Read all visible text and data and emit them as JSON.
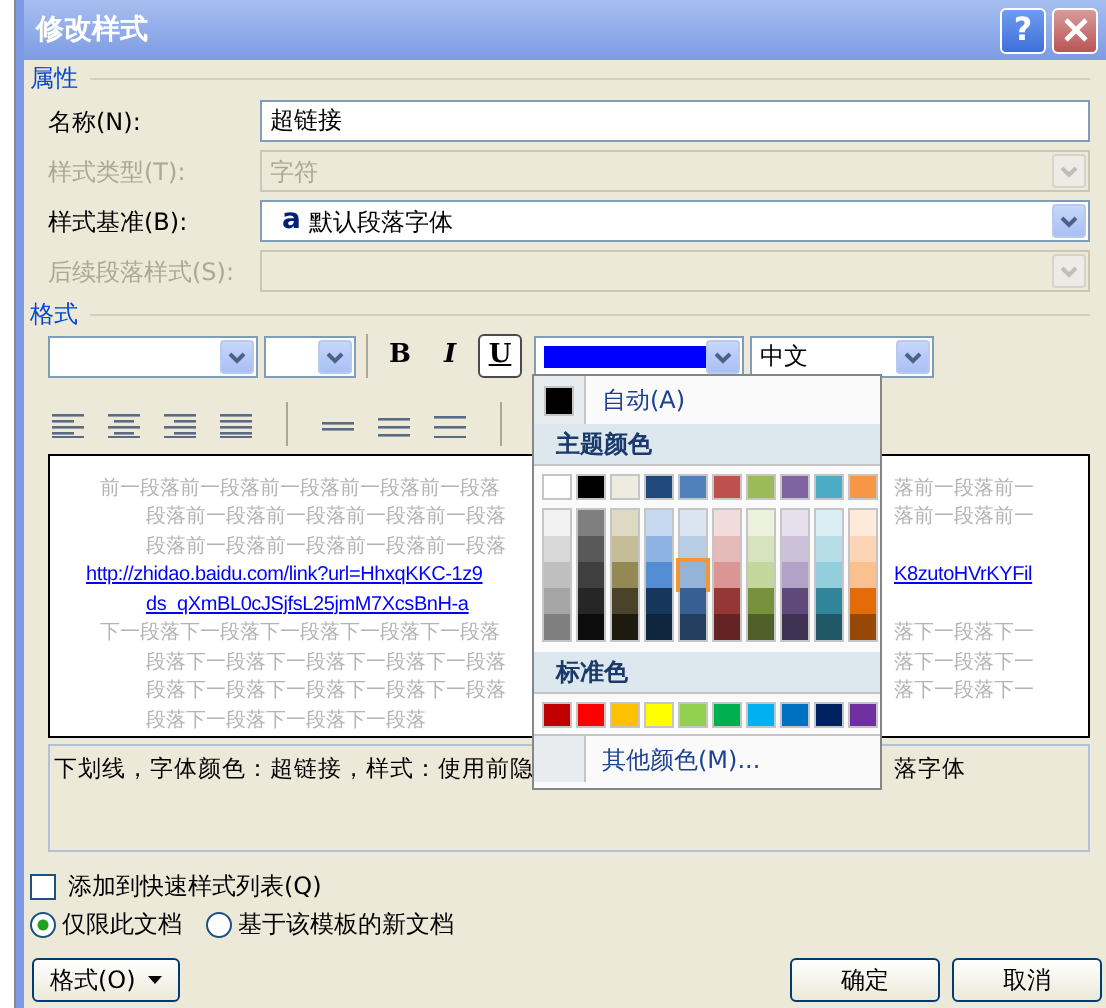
{
  "window": {
    "title": "修改样式",
    "help": "?"
  },
  "properties": {
    "heading": "属性",
    "fields": [
      {
        "label": "名称(N):",
        "kind": "text",
        "value": "超链接",
        "disabled": false
      },
      {
        "label": "样式类型(T):",
        "kind": "select",
        "value": "字符",
        "disabled": true
      },
      {
        "label": "样式基准(B):",
        "kind": "select",
        "value": "默认段落字体",
        "icon": "a",
        "disabled": false
      },
      {
        "label": "后续段落样式(S):",
        "kind": "select",
        "disabled": true
      }
    ]
  },
  "format": {
    "heading": "格式",
    "toolbar": {
      "bold": {
        "label": "B",
        "on": false
      },
      "italic": {
        "label": "I",
        "on": false
      },
      "underline": {
        "label": "U",
        "on": true
      },
      "font_color": {
        "color": "#0000ff"
      },
      "language": "中文"
    },
    "preview": [
      {
        "kind": "para-start",
        "left": "前一段落前一段落前一段落前一段落前一段落",
        "right": "落前一段落前一"
      },
      {
        "kind": "continuation",
        "left": "段落前一段落前一段落前一段落前一段落",
        "right": "落前一段落前一"
      },
      {
        "kind": "continuation",
        "left": "段落前一段落前一段落前一段落前一段落"
      },
      {
        "kind": "link",
        "left": "http://zhidao.baidu.com/link?url=HhxqKKC-1z9",
        "right": "K8zutoHVrKYFil"
      },
      {
        "kind": "link-continuation",
        "left": "ds_qXmBL0cJSjfsL25jmM7XcsBnH-a"
      },
      {
        "kind": "para-start",
        "left": "下一段落下一段落下一段落下一段落下一段落",
        "right": "落下一段落下一"
      },
      {
        "kind": "continuation",
        "left": "段落下一段落下一段落下一段落下一段落",
        "right": "落下一段落下一"
      },
      {
        "kind": "continuation",
        "left": "段落下一段落下一段落下一段落下一段落",
        "right": "落下一段落下一"
      },
      {
        "kind": "continuation",
        "left": "段落下一段落下一段落下一段落"
      }
    ],
    "description": {
      "left": "下划线，字体颜色：超链接，样式：使用前隐",
      "right": "落字体"
    }
  },
  "palette": {
    "auto": {
      "label": "自动(A)",
      "color": "#000000"
    },
    "theme_heading": "主题颜色",
    "theme": [
      {
        "color": "#ffffff",
        "selected": false
      },
      {
        "color": "#000000",
        "selected": false
      },
      {
        "color": "#eeece1",
        "selected": false
      },
      {
        "color": "#1f497d",
        "selected": false
      },
      {
        "color": "#4f81bd",
        "selected": false
      },
      {
        "color": "#c0504d",
        "selected": false
      },
      {
        "color": "#9bbb59",
        "selected": false
      },
      {
        "color": "#8064a2",
        "selected": false
      },
      {
        "color": "#4bacc6",
        "selected": false
      },
      {
        "color": "#f79646",
        "selected": false
      }
    ],
    "shade_columns": [
      [
        {
          "color": "#f2f2f2",
          "selected": false
        },
        {
          "color": "#d8d8d8",
          "selected": false
        },
        {
          "color": "#bfbfbf",
          "selected": false
        },
        {
          "color": "#a5a5a5",
          "selected": false
        },
        {
          "color": "#7f7f7f",
          "selected": false
        }
      ],
      [
        {
          "color": "#7f7f7f",
          "selected": false
        },
        {
          "color": "#595959",
          "selected": false
        },
        {
          "color": "#3f3f3f",
          "selected": false
        },
        {
          "color": "#262626",
          "selected": false
        },
        {
          "color": "#0c0c0c",
          "selected": false
        }
      ],
      [
        {
          "color": "#ddd9c3",
          "selected": false
        },
        {
          "color": "#c4bd97",
          "selected": false
        },
        {
          "color": "#938953",
          "selected": false
        },
        {
          "color": "#494429",
          "selected": false
        },
        {
          "color": "#1d1b10",
          "selected": false
        }
      ],
      [
        {
          "color": "#c6d9f0",
          "selected": false
        },
        {
          "color": "#8db3e2",
          "selected": false
        },
        {
          "color": "#548dd4",
          "selected": false
        },
        {
          "color": "#17365d",
          "selected": false
        },
        {
          "color": "#0f243e",
          "selected": false
        }
      ],
      [
        {
          "color": "#dbe5f1",
          "selected": false
        },
        {
          "color": "#b8cce4",
          "selected": false
        },
        {
          "color": "#95b3d7",
          "selected": true
        },
        {
          "color": "#366092",
          "selected": false
        },
        {
          "color": "#244061",
          "selected": false
        }
      ],
      [
        {
          "color": "#f2dcdb",
          "selected": false
        },
        {
          "color": "#e5b9b7",
          "selected": false
        },
        {
          "color": "#d99694",
          "selected": false
        },
        {
          "color": "#953734",
          "selected": false
        },
        {
          "color": "#632423",
          "selected": false
        }
      ],
      [
        {
          "color": "#ebf1dd",
          "selected": false
        },
        {
          "color": "#d7e3bc",
          "selected": false
        },
        {
          "color": "#c3d69b",
          "selected": false
        },
        {
          "color": "#76923c",
          "selected": false
        },
        {
          "color": "#4f6128",
          "selected": false
        }
      ],
      [
        {
          "color": "#e5e0ec",
          "selected": false
        },
        {
          "color": "#ccc1d9",
          "selected": false
        },
        {
          "color": "#b2a2c7",
          "selected": false
        },
        {
          "color": "#5f497a",
          "selected": false
        },
        {
          "color": "#3f3151",
          "selected": false
        }
      ],
      [
        {
          "color": "#dbeef3",
          "selected": false
        },
        {
          "color": "#b7dde8",
          "selected": false
        },
        {
          "color": "#92cddc",
          "selected": false
        },
        {
          "color": "#31859b",
          "selected": false
        },
        {
          "color": "#205867",
          "selected": false
        }
      ],
      [
        {
          "color": "#fdeada",
          "selected": false
        },
        {
          "color": "#fbd5b5",
          "selected": false
        },
        {
          "color": "#fac08f",
          "selected": false
        },
        {
          "color": "#e36c09",
          "selected": false
        },
        {
          "color": "#974806",
          "selected": false
        }
      ]
    ],
    "standard_heading": "标准色",
    "standard": [
      {
        "color": "#c00000",
        "selected": false
      },
      {
        "color": "#ff0000",
        "selected": false
      },
      {
        "color": "#ffc000",
        "selected": false
      },
      {
        "color": "#ffff00",
        "selected": false
      },
      {
        "color": "#92d050",
        "selected": false
      },
      {
        "color": "#00b050",
        "selected": false
      },
      {
        "color": "#00b0f0",
        "selected": false
      },
      {
        "color": "#0070c0",
        "selected": false
      },
      {
        "color": "#002060",
        "selected": false
      },
      {
        "color": "#7030a0",
        "selected": false
      }
    ],
    "more": "其他颜色(M)..."
  },
  "options": {
    "quick_style": {
      "label": "添加到快速样式列表(Q)",
      "checked": false
    },
    "scope": [
      {
        "label": "仅限此文档",
        "selected": true
      },
      {
        "label": "基于该模板的新文档",
        "selected": false
      }
    ]
  },
  "buttons": {
    "format": "格式(O)",
    "ok": "确定",
    "cancel": "取消"
  }
}
